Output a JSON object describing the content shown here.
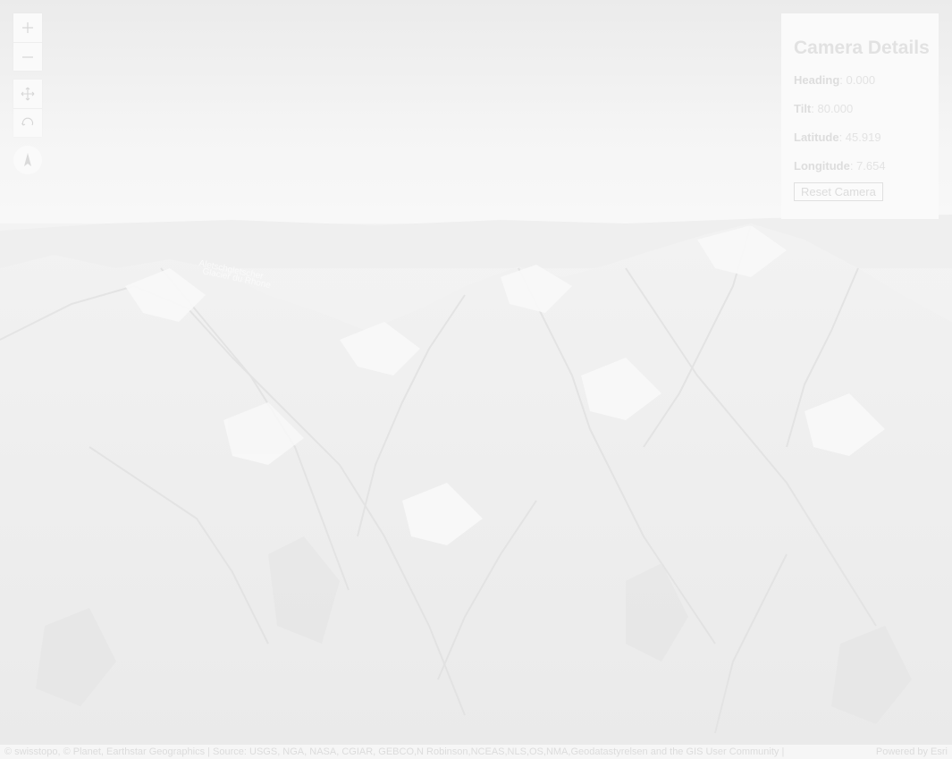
{
  "camera_panel": {
    "title": "Camera Details",
    "heading": {
      "label": "Heading",
      "value": ": 0.000"
    },
    "tilt": {
      "label": "Tilt",
      "value": ": 80.000"
    },
    "latitude": {
      "label": "Latitude",
      "value": ": 45.919"
    },
    "longitude": {
      "label": "Longitude",
      "value": ": 7.654"
    },
    "reset_label": "Reset Camera"
  },
  "map_labels": {
    "glacier_label_1": "Aletschgletscher",
    "glacier_label_2": "Glacier du Rhone"
  },
  "attribution": {
    "text": "© swisstopo, © Planet, Earthstar Geographics | Source: USGS, NGA, NASA, CGIAR, GEBCO,N Robinson,NCEAS,NLS,OS,NMA,Geodatastyrelsen and the GIS User Community |",
    "powered_by": "Powered by Esri"
  },
  "nav_controls": {
    "icons": [
      "zoom-in-icon",
      "zoom-out-icon",
      "pan-icon",
      "rotate-icon",
      "compass-icon"
    ]
  },
  "colors": {
    "panel_background": "#fafafa",
    "muted_text": "#e0e0e0",
    "sky": "#f4f4f4"
  }
}
